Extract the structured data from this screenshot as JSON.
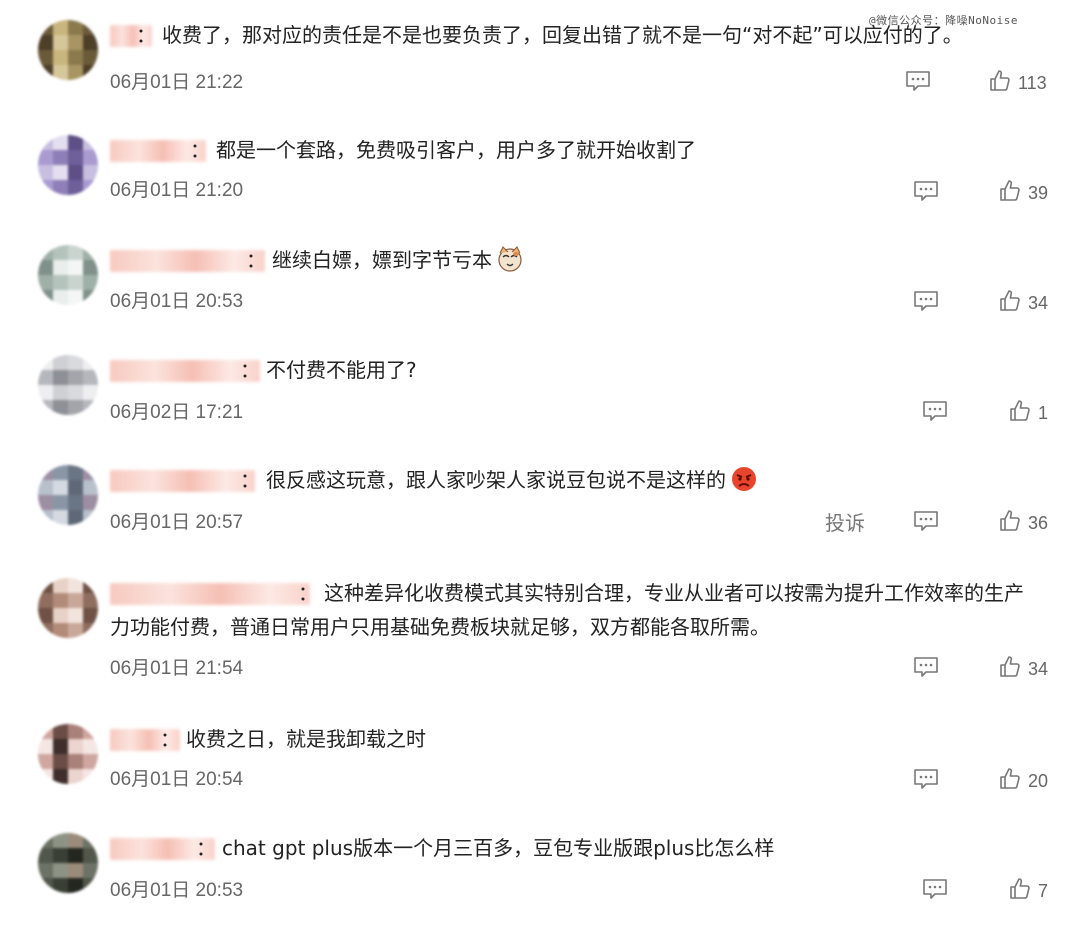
{
  "watermark": "@微信公众号：降噪NoNoise",
  "comments": [
    {
      "text": "收费了，那对应的责任是不是也要负责了，回复出错了就不是一句“对不起”可以应付的了。",
      "time": "06月01日 21:22",
      "likes": "113"
    },
    {
      "text": "都是一个套路，免费吸引客户，用户多了就开始收割了",
      "time": "06月01日 21:20",
      "likes": "39"
    },
    {
      "text": "继续白嫖，嫖到字节亏本",
      "time": "06月01日 20:53",
      "likes": "34",
      "emoji": "cat-face-emoji"
    },
    {
      "text": "不付费不能用了?",
      "time": "06月02日 17:21",
      "likes": "1"
    },
    {
      "text": "很反感这玩意，跟人家吵架人家说豆包说不是这样的",
      "time": "06月01日 20:57",
      "likes": "36",
      "emoji": "angry-face-emoji",
      "report": "投诉"
    },
    {
      "text": "这种差异化收费模式其实特别合理，专业从业者可以按需为提升工作效率的生产",
      "text2": "力功能付费，普通日常用户只用基础免费板块就足够，双方都能各取所需。",
      "time": "06月01日 21:54",
      "likes": "34"
    },
    {
      "text": "收费之日，就是我卸载之时",
      "time": "06月01日 20:54",
      "likes": "20"
    },
    {
      "text": "chat gpt plus版本一个月三百多，豆包专业版跟plus比怎么样",
      "time": "06月01日 20:53",
      "likes": "7"
    }
  ],
  "icons": {
    "reply": "comment-icon",
    "like": "thumbs-up-icon"
  },
  "colors": {
    "text": "#222222",
    "meta": "#666666",
    "blurred_name": "#f5bfb4"
  }
}
